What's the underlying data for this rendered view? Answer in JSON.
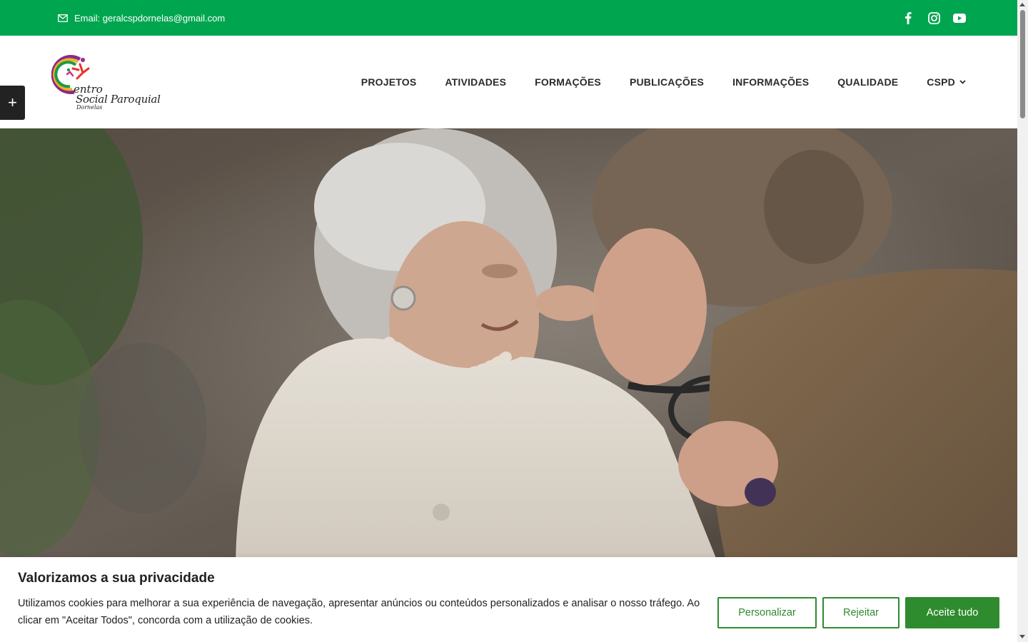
{
  "topbar": {
    "email_label": "Email: geralcspdornelas@gmail.com",
    "background": "#00a64f",
    "social_icons": [
      "facebook-icon",
      "instagram-icon",
      "youtube-icon"
    ]
  },
  "logo": {
    "line1": "entro",
    "line2": "Social Paroquial",
    "line3": "Dornelas"
  },
  "nav": {
    "items": [
      {
        "label": "PROJETOS"
      },
      {
        "label": "ATIVIDADES"
      },
      {
        "label": "FORMAÇÕES"
      },
      {
        "label": "PUBLICAÇÕES"
      },
      {
        "label": "INFORMAÇÕES"
      },
      {
        "label": "QUALIDADE"
      },
      {
        "label": "CSPD",
        "has_dropdown": true
      }
    ]
  },
  "sidebar_toggle": {
    "icon": "plus-icon",
    "label": "+"
  },
  "cookie": {
    "title": "Valorizamos a sua privacidade",
    "text": "Utilizamos cookies para melhorar a sua experiência de navegação, apresentar anúncios ou conteúdos personalizados e analisar o nosso tráfego. Ao clicar em \"Aceitar Todos\", concorda com a utilização de cookies.",
    "buttons": {
      "customize": "Personalizar",
      "reject": "Rejeitar",
      "accept": "Aceite tudo"
    },
    "accent": "#2e8b2e"
  }
}
